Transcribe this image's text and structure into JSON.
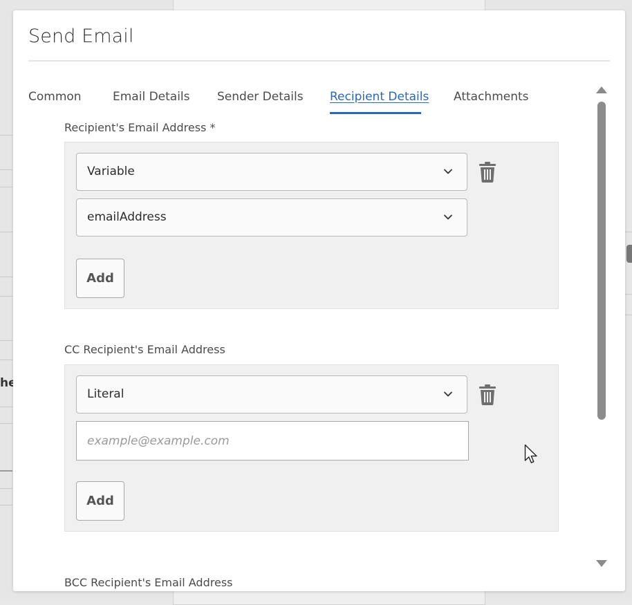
{
  "dialog": {
    "title": "Send Email",
    "help_icon": "help-icon",
    "fullscreen_icon": "fullscreen-icon",
    "close_icon": "close-icon",
    "confirm_icon": "check-icon"
  },
  "tabs": [
    {
      "label": "Common",
      "active": false
    },
    {
      "label": "Email Details",
      "active": false
    },
    {
      "label": "Sender Details",
      "active": false
    },
    {
      "label": "Recipient Details",
      "active": true
    },
    {
      "label": "Attachments",
      "active": false
    }
  ],
  "recipient": {
    "label": "Recipient's Email Address *",
    "type_value": "Variable",
    "variable_value": "emailAddress",
    "add_label": "Add"
  },
  "cc": {
    "label": "CC Recipient's Email Address",
    "type_value": "Literal",
    "input_placeholder": "example@example.com",
    "add_label": "Add"
  },
  "bcc": {
    "label": "BCC Recipient's Email Address"
  },
  "background": {
    "partial_text": "he"
  },
  "colors": {
    "accent": "#2768b9",
    "panel": "#f0f0f0",
    "icon": "#6e6e6e"
  }
}
